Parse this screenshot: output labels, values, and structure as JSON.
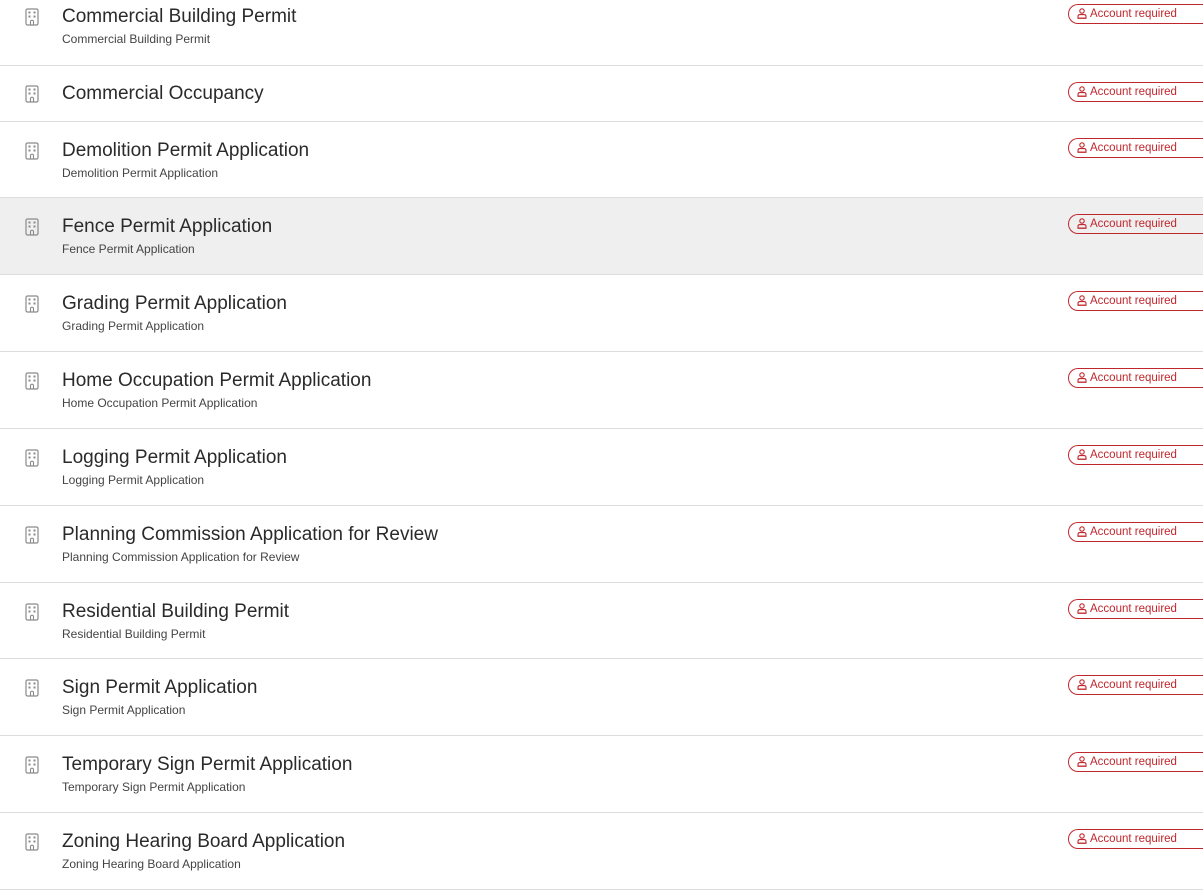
{
  "badge_label": "Account required",
  "accent_color": "#c0272d",
  "items": [
    {
      "title": "Commercial Building Permit",
      "subtitle": "Commercial Building Permit"
    },
    {
      "title": "Commercial Occupancy",
      "subtitle": ""
    },
    {
      "title": "Demolition Permit Application",
      "subtitle": "Demolition Permit Application"
    },
    {
      "title": "Fence Permit Application",
      "subtitle": "Fence Permit Application"
    },
    {
      "title": "Grading Permit Application",
      "subtitle": "Grading Permit Application"
    },
    {
      "title": "Home Occupation Permit Application",
      "subtitle": "Home Occupation Permit Application"
    },
    {
      "title": "Logging Permit Application",
      "subtitle": "Logging Permit Application"
    },
    {
      "title": "Planning Commission Application for Review",
      "subtitle": "Planning Commission Application for Review"
    },
    {
      "title": "Residential Building Permit",
      "subtitle": "Residential Building Permit"
    },
    {
      "title": "Sign Permit Application",
      "subtitle": "Sign Permit Application"
    },
    {
      "title": "Temporary Sign Permit Application",
      "subtitle": "Temporary Sign Permit Application"
    },
    {
      "title": "Zoning Hearing Board Application",
      "subtitle": "Zoning Hearing Board Application"
    }
  ],
  "hovered_index": 3,
  "item_icon": "building-icon",
  "badge_icon": "user-icon"
}
